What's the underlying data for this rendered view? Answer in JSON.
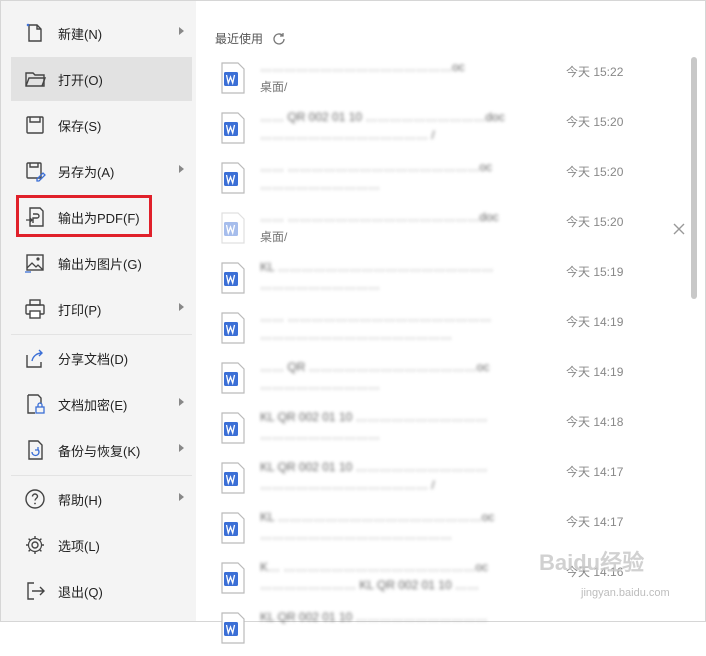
{
  "menu": {
    "items": [
      {
        "label": "新建(N)",
        "icon": "new-file-icon",
        "submenu": true
      },
      {
        "label": "打开(O)",
        "icon": "folder-open-icon",
        "submenu": false,
        "active": true
      },
      {
        "label": "保存(S)",
        "icon": "save-icon",
        "submenu": false
      },
      {
        "label": "另存为(A)",
        "icon": "save-as-icon",
        "submenu": true
      },
      {
        "label": "输出为PDF(F)",
        "icon": "export-pdf-icon",
        "submenu": false,
        "highlighted": true
      },
      {
        "label": "输出为图片(G)",
        "icon": "export-image-icon",
        "submenu": false
      },
      {
        "label": "打印(P)",
        "icon": "printer-icon",
        "submenu": true
      },
      {
        "label": "分享文档(D)",
        "icon": "share-icon",
        "submenu": false
      },
      {
        "label": "文档加密(E)",
        "icon": "lock-document-icon",
        "submenu": true
      },
      {
        "label": "备份与恢复(K)",
        "icon": "backup-icon",
        "submenu": true
      },
      {
        "label": "帮助(H)",
        "icon": "help-icon",
        "submenu": true
      },
      {
        "label": "选项(L)",
        "icon": "gear-icon",
        "submenu": false
      },
      {
        "label": "退出(Q)",
        "icon": "exit-icon",
        "submenu": false
      }
    ]
  },
  "recent": {
    "title": "最近使用",
    "files": [
      {
        "name": "…………………………………………oc",
        "path": "桌面/",
        "time": "今天 15:22"
      },
      {
        "name": "…… QR 002 01 10 …………………………doc",
        "path": "…………………………………… /",
        "time": "今天 15:20"
      },
      {
        "name": "…… …………………………………………oc",
        "path": "…………………………",
        "time": "今天 15:20"
      },
      {
        "name": "…… …………………………………………doc",
        "path": "桌面/",
        "time": "今天 15:20"
      },
      {
        "name": "KL ………………………………………………",
        "path": "…………………………",
        "time": "今天 15:19"
      },
      {
        "name": "…… ……………………………………………",
        "path": "…………………………………………",
        "time": "今天 14:19"
      },
      {
        "name": "…… QR ……………………………………oc",
        "path": "…………………………",
        "time": "今天 14:19"
      },
      {
        "name": "KL QR 002 01 10 ……………………………",
        "path": "…………………………",
        "time": "今天 14:18"
      },
      {
        "name": "KL QR 002 01 10 ……………………………",
        "path": "…………………………………… /",
        "time": "今天 14:17"
      },
      {
        "name": "KL ……………………………………………oc",
        "path": "…………………………………………",
        "time": "今天 14:17"
      },
      {
        "name": "K… …………………………………………oc",
        "path": "…………………… KL QR 002 01 10 ……",
        "time": "今天 14:16"
      },
      {
        "name": "KL QR 002 01 10 ……………………………",
        "path": "",
        "time": ""
      }
    ]
  },
  "watermark": {
    "text": "Baidu经验",
    "sub": "jingyan.baidu.com"
  },
  "colors": {
    "highlight": "#e0202a",
    "wps_blue": "#3b6fd6",
    "menu_bg": "#f4f4f4"
  }
}
